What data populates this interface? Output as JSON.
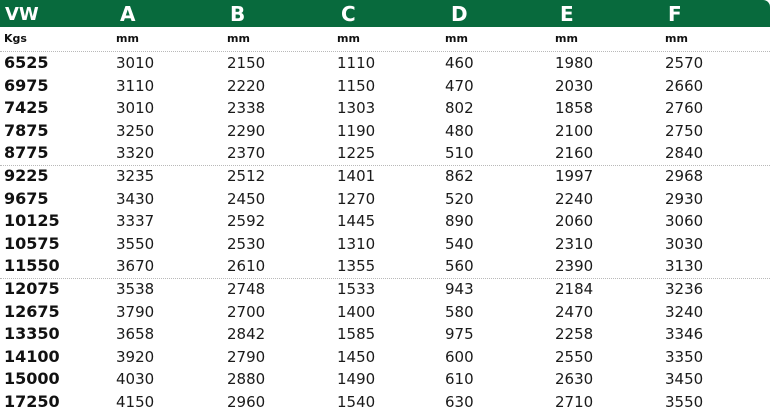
{
  "header": {
    "columns": [
      "VW",
      "A",
      "B",
      "C",
      "D",
      "E",
      "F"
    ]
  },
  "units": [
    "Kgs",
    "mm",
    "mm",
    "mm",
    "mm",
    "mm",
    "mm"
  ],
  "colors": {
    "header_background": "#086a3d",
    "header_text": "#ffffff",
    "divider": "#b9b9b9"
  },
  "rows": [
    [
      "6525",
      "3010",
      "2150",
      "1110",
      "460",
      "1980",
      "2570"
    ],
    [
      "6975",
      "3110",
      "2220",
      "1150",
      "470",
      "2030",
      "2660"
    ],
    [
      "7425",
      "3010",
      "2338",
      "1303",
      "802",
      "1858",
      "2760"
    ],
    [
      "7875",
      "3250",
      "2290",
      "1190",
      "480",
      "2100",
      "2750"
    ],
    [
      "8775",
      "3320",
      "2370",
      "1225",
      "510",
      "2160",
      "2840"
    ],
    [
      "9225",
      "3235",
      "2512",
      "1401",
      "862",
      "1997",
      "2968"
    ],
    [
      "9675",
      "3430",
      "2450",
      "1270",
      "520",
      "2240",
      "2930"
    ],
    [
      "10125",
      "3337",
      "2592",
      "1445",
      "890",
      "2060",
      "3060"
    ],
    [
      "10575",
      "3550",
      "2530",
      "1310",
      "540",
      "2310",
      "3030"
    ],
    [
      "11550",
      "3670",
      "2610",
      "1355",
      "560",
      "2390",
      "3130"
    ],
    [
      "12075",
      "3538",
      "2748",
      "1533",
      "943",
      "2184",
      "3236"
    ],
    [
      "12675",
      "3790",
      "2700",
      "1400",
      "580",
      "2470",
      "3240"
    ],
    [
      "13350",
      "3658",
      "2842",
      "1585",
      "975",
      "2258",
      "3346"
    ],
    [
      "14100",
      "3920",
      "2790",
      "1450",
      "600",
      "2550",
      "3350"
    ],
    [
      "15000",
      "4030",
      "2880",
      "1490",
      "610",
      "2630",
      "3450"
    ],
    [
      "17250",
      "4150",
      "2960",
      "1540",
      "630",
      "2710",
      "3550"
    ]
  ]
}
